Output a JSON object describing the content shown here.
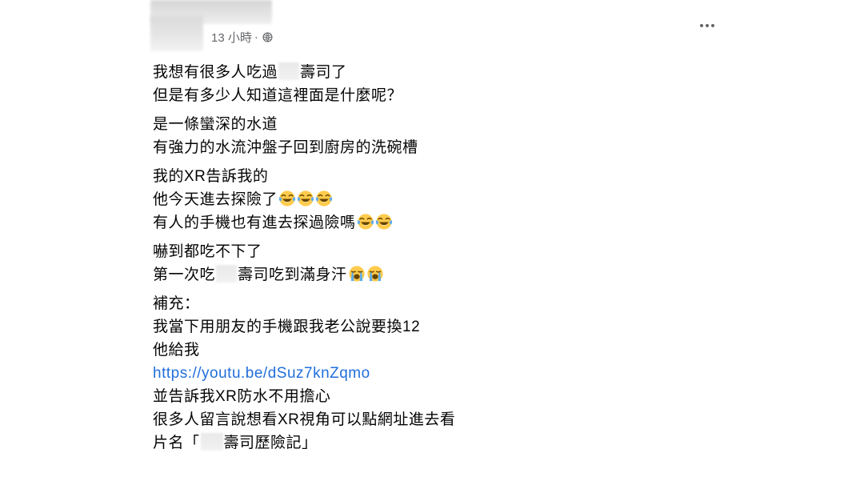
{
  "header": {
    "timestamp": "13 小時",
    "separator": " · ",
    "privacy_icon": "globe-icon",
    "more_icon": "more-options-icon"
  },
  "post": {
    "p1": {
      "l1a": "我想有很多人吃過",
      "l1b": "壽司了",
      "l2": "但是有多少人知道這裡面是什麼呢？"
    },
    "p2": {
      "l1": "是一條蠻深的水道",
      "l2": "有強力的水流沖盤子回到廚房的洗碗槽"
    },
    "p3": {
      "l1": "我的XR告訴我的",
      "l2": "他今天進去探險了",
      "l3": "有人的手機也有進去探過險嗎",
      "emoji_name": "face-with-tears-of-joy"
    },
    "p4": {
      "l1": "嚇到都吃不下了",
      "l2a": "第一次吃",
      "l2b": "壽司吃到滿身汗",
      "emoji_name": "loudly-crying-face"
    },
    "p5": {
      "l1": "補充：",
      "l2": "我當下用朋友的手機跟我老公說要換12",
      "l3": "他給我",
      "link": "https://youtu.be/dSuz7knZqmo",
      "l5": "並告訴我XR防水不用擔心",
      "l6": "很多人留言說想看XR視角可以點網址進去看",
      "l7a": "片名「",
      "l7b": "壽司歷險記」"
    }
  },
  "colors": {
    "text": "#050505",
    "meta": "#65676b",
    "link": "#216fdb",
    "emoji_face": "#ffcb4c",
    "tears": "#5dadec"
  }
}
